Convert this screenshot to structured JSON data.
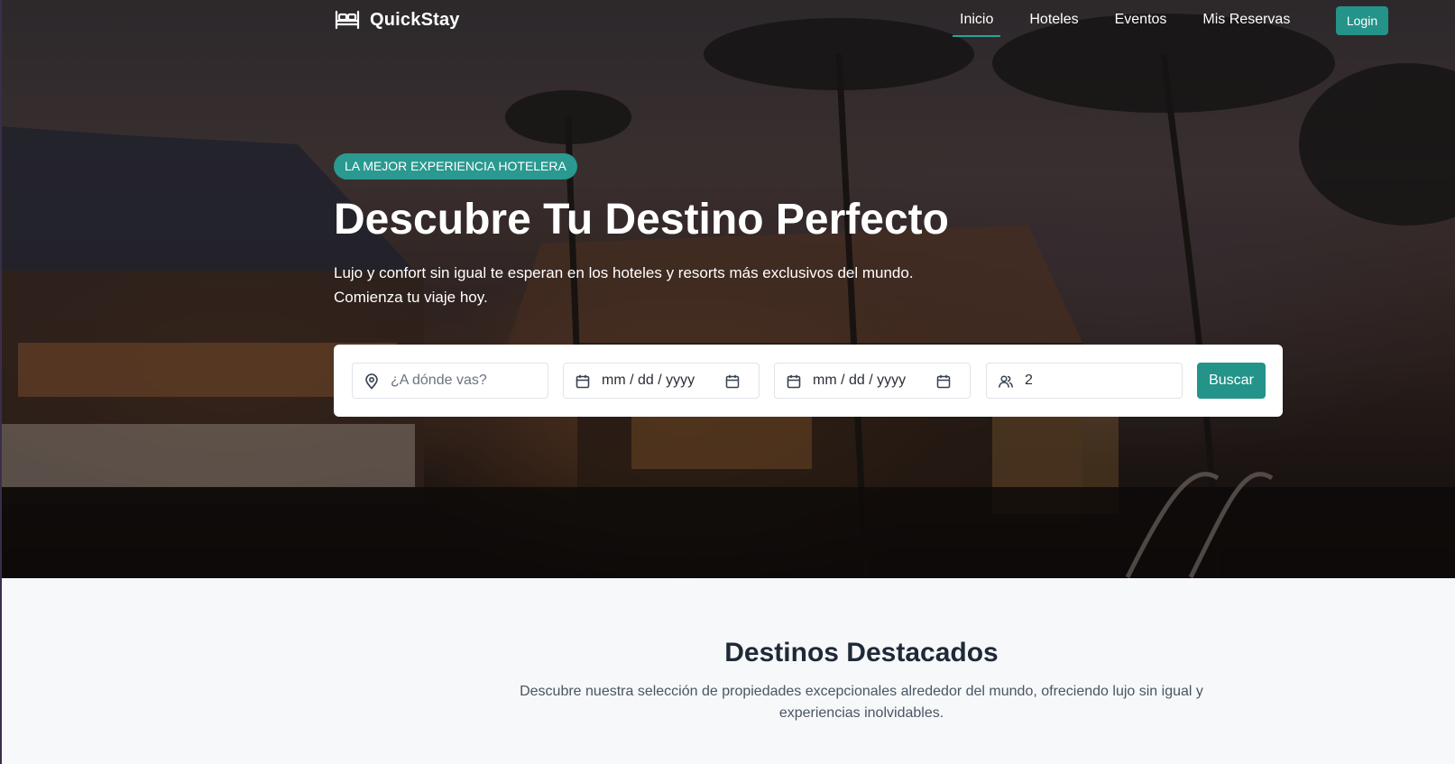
{
  "brand": {
    "name": "QuickStay",
    "icon": "bed-icon"
  },
  "nav": {
    "links": [
      {
        "label": "Inicio",
        "active": true
      },
      {
        "label": "Hoteles",
        "active": false
      },
      {
        "label": "Eventos",
        "active": false
      },
      {
        "label": "Mis Reservas",
        "active": false
      }
    ],
    "login_label": "Login"
  },
  "hero": {
    "badge": "LA MEJOR EXPERIENCIA HOTELERA",
    "title": "Descubre Tu Destino Perfecto",
    "subtitle": "Lujo y confort sin igual te esperan en los hoteles y resorts más exclusivos del mundo. Comienza tu viaje hoy."
  },
  "search": {
    "destination_placeholder": "¿A dónde vas?",
    "checkin_value": "mm / dd / yyyy",
    "checkout_value": "mm / dd / yyyy",
    "guests_value": "2",
    "button_label": "Buscar"
  },
  "featured": {
    "title": "Destinos Destacados",
    "description": "Descubre nuestra selección de propiedades excepcionales alrededor del mundo, ofreciendo lujo sin igual y experiencias inolvidables."
  },
  "colors": {
    "accent": "#24938a",
    "badge": "#2a9990",
    "section_bg": "#f6f8fa"
  }
}
